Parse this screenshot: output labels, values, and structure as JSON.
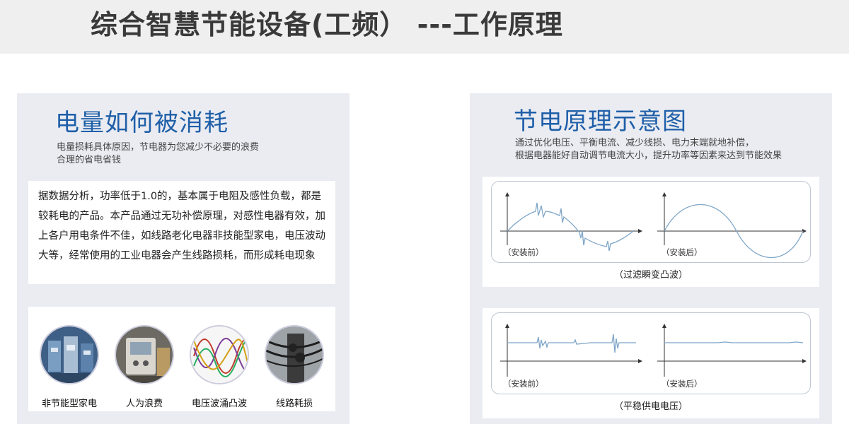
{
  "header": {
    "title": "综合智慧节能设备(工频） ---工作原理"
  },
  "left": {
    "heading": "电量如何被消耗",
    "sub_line1": "电量损耗具体原因，节电器为您减少不必要的浪费",
    "sub_line2": "合理的省电省钱",
    "body_text": "据数据分析，功率低于1.0的，基本属于电阻及感性负载，都是较耗电的产品。本产品通过无功补偿原理，对感性电器有效，加上各户用电条件不佳，如线路老化电器非技能型家电，电压波动大等，经常使用的工业电器会产生线路损耗，而形成耗电现象",
    "items": [
      {
        "label": "非节能型家电",
        "icon": "machinery-icon"
      },
      {
        "label": "人为浪费",
        "icon": "appliance-icon"
      },
      {
        "label": "电压波涌凸波",
        "icon": "waveform-icon"
      },
      {
        "label": "线路耗损",
        "icon": "wires-icon"
      }
    ]
  },
  "right": {
    "heading": "节电原理示意图",
    "sub_line1": "通过优化电压、平衡电流、减少线损、电力末端就地补偿，",
    "sub_line2": "根据电器能好自动调节电流大小，提升功率等因素来达到节能效果",
    "chart1": {
      "before": "（安装前）",
      "after": "（安装后）",
      "caption": "（过滤瞬变凸波）"
    },
    "chart2": {
      "before": "（安装前）",
      "after": "（安装后）",
      "caption": "（平稳供电电压）"
    }
  },
  "colors": {
    "heading_blue": "#1f5fa8",
    "panel_bg": "#eaecf2",
    "wave": "#7fa6c8"
  }
}
